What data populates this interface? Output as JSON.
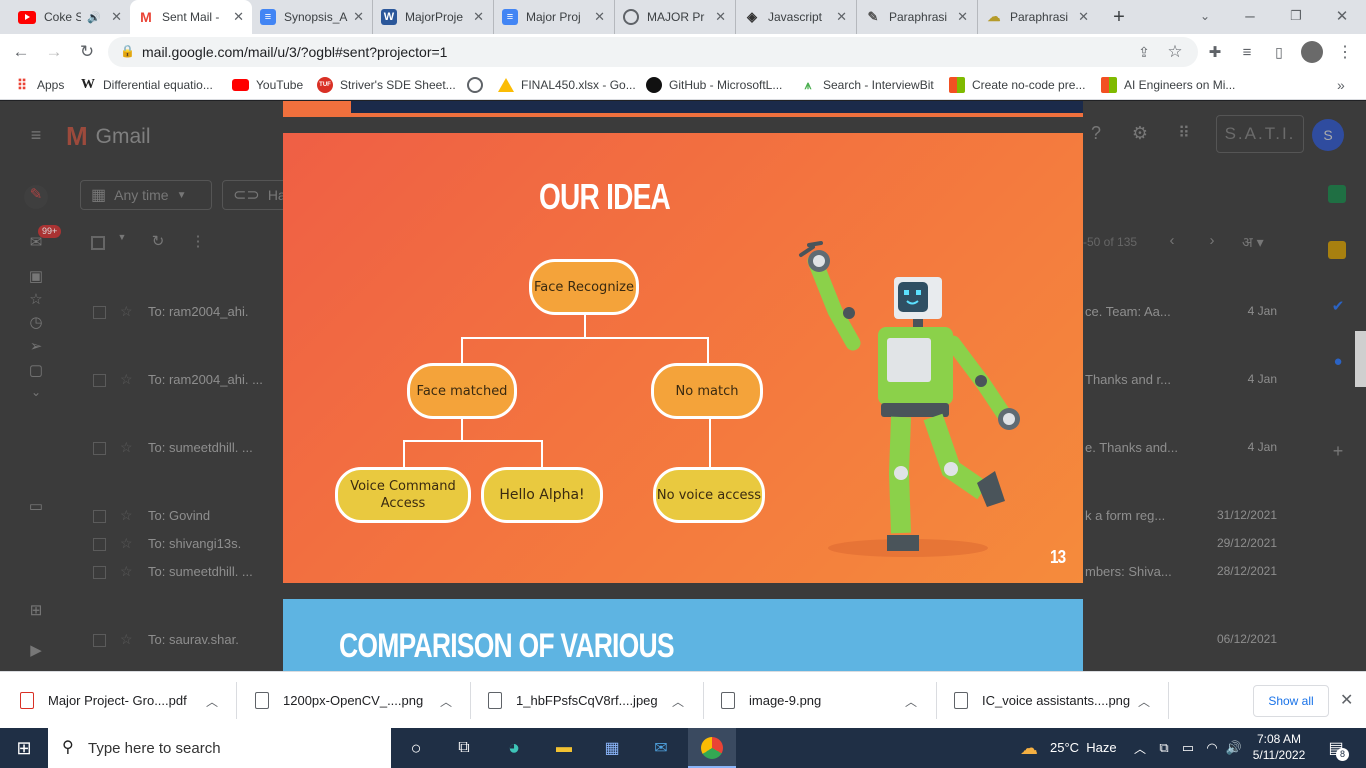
{
  "tabs": [
    {
      "label": "Coke S",
      "icon": "youtube-icon"
    },
    {
      "label": "Sent Mail -",
      "icon": "gmail-icon"
    },
    {
      "label": "Synopsis_A",
      "icon": "docs-icon"
    },
    {
      "label": "MajorProje",
      "icon": "word-icon"
    },
    {
      "label": "Major Proj",
      "icon": "docs-icon"
    },
    {
      "label": "MAJOR Pr",
      "icon": "globe-icon"
    },
    {
      "label": "Javascript",
      "icon": "code-icon"
    },
    {
      "label": "Paraphrasi",
      "icon": "pen-icon"
    },
    {
      "label": "Paraphrasi",
      "icon": "paraphrase-icon"
    }
  ],
  "address": {
    "url": "mail.google.com/mail/u/3/?ogbl#sent?projector=1"
  },
  "bookmarks": [
    {
      "label": "Apps"
    },
    {
      "label": "Differential equatio..."
    },
    {
      "label": "YouTube"
    },
    {
      "label": "Striver's SDE Sheet..."
    },
    {
      "label": ""
    },
    {
      "label": "FINAL450.xlsx - Go..."
    },
    {
      "label": "GitHub - MicrosoftL..."
    },
    {
      "label": "Search - InterviewBit"
    },
    {
      "label": "Create no-code pre..."
    },
    {
      "label": "AI Engineers on Mi..."
    }
  ],
  "gmail": {
    "brand": "Gmail",
    "filters": {
      "time": "Any time",
      "has": "Has"
    },
    "unread_badge": "99+",
    "pagination": "-50 of 135",
    "lang": "अ",
    "account_logo": "S.A.T.I.",
    "avatar": "S",
    "rows": [
      {
        "to": "To: ram2004_ahi.",
        "snippet": "ce. Team: Aa...",
        "date": "4 Jan"
      },
      {
        "to": "To: ram2004_ahi. ...",
        "snippet": "Thanks and r...",
        "date": "4 Jan"
      },
      {
        "to": "To: sumeetdhill. ...",
        "snippet": "e. Thanks and...",
        "date": "4 Jan"
      },
      {
        "to": "To: Govind",
        "snippet": "k a form reg...",
        "date": "31/12/2021"
      },
      {
        "to": "To: shivangi13s.",
        "snippet": "",
        "date": "29/12/2021"
      },
      {
        "to": "To: sumeetdhill. ...",
        "snippet": "mbers: Shiva...",
        "date": "28/12/2021"
      },
      {
        "to": "To: saurav.shar.",
        "snippet": "",
        "date": "06/12/2021"
      }
    ]
  },
  "slide": {
    "title": "OUR IDEA",
    "page_number": "13",
    "nodes": {
      "root": "Face Recognize",
      "matched": "Face matched",
      "nomatch": "No match",
      "voice": "Voice Command Access",
      "hello": "Hello Alpha!",
      "novoice": "No voice access"
    }
  },
  "slide2": {
    "title": "COMPARISON OF VARIOUS"
  },
  "downloads": {
    "items": [
      {
        "label": "Major Project- Gro....pdf"
      },
      {
        "label": "1200px-OpenCV_....png"
      },
      {
        "label": "1_hbFPsfsCqV8rf....jpeg"
      },
      {
        "label": "image-9.png"
      },
      {
        "label": "IC_voice assistants....png"
      }
    ],
    "show_all": "Show all"
  },
  "taskbar": {
    "search_placeholder": "Type here to search",
    "weather": "25°C  Haze",
    "time": "7:08 AM",
    "date": "5/11/2022",
    "notifications": "8"
  }
}
